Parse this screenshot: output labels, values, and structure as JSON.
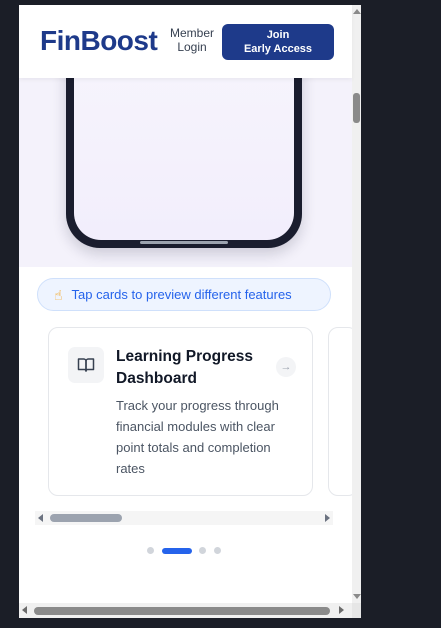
{
  "header": {
    "logo_text": "FinBoost",
    "member_login_line1": "Member",
    "member_login_line2": "Login",
    "join_line1": "Join",
    "join_line2": "Early Access"
  },
  "hint": {
    "icon": "pointing-hand-icon",
    "text": "Tap cards to preview different features"
  },
  "cards": [
    {
      "icon": "open-book-icon",
      "title": "Learning Progress Dashboard",
      "description": "Track your progress through financial modules with clear point totals and completion rates"
    }
  ],
  "carousel": {
    "dot_count": 4,
    "active_index": 1
  },
  "colors": {
    "brand": "#1e3a8a",
    "accent": "#2563eb"
  }
}
